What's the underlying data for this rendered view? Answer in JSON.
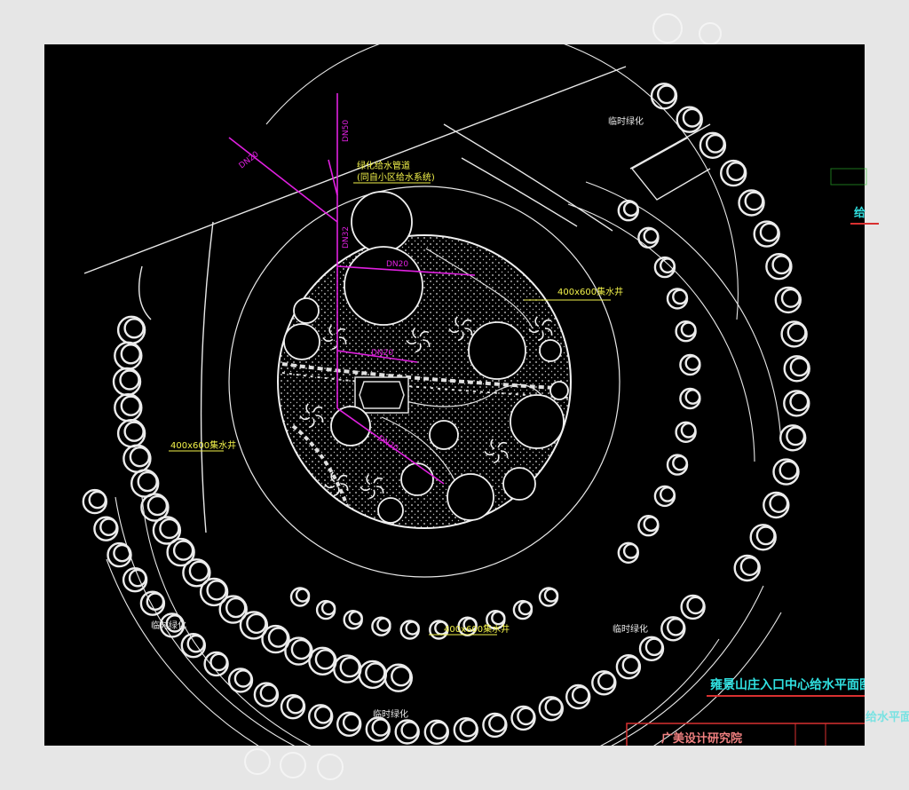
{
  "drawing": {
    "title": "雍景山庄入口中心给水平面图",
    "institute": "广美设计研究院",
    "bg": "#000000",
    "colors": {
      "outline": "#e8e8e8",
      "pipe": "#e020e0",
      "note": "#f2f24a",
      "title": "#30e0e0",
      "frame": "#d83030"
    }
  },
  "labels": {
    "pipe_note_1": "绿化给水管道",
    "pipe_note_2": "(同自小区给水系统)",
    "green_temp_1": "临时绿化",
    "green_temp_2": "临时绿化",
    "green_temp_3": "临时绿化",
    "green_temp_4": "临时绿化",
    "well_1": "400x600集水井",
    "well_2": "400x600集水井",
    "well_3": "400x600集水井",
    "dn_1": "DN50",
    "dn_2": "DN32",
    "dn_3": "DN20",
    "dn_4": "DN20",
    "dn_5": "DN20",
    "dn_6": "DN20",
    "side_label": "给",
    "title_frag": "给水平面"
  }
}
